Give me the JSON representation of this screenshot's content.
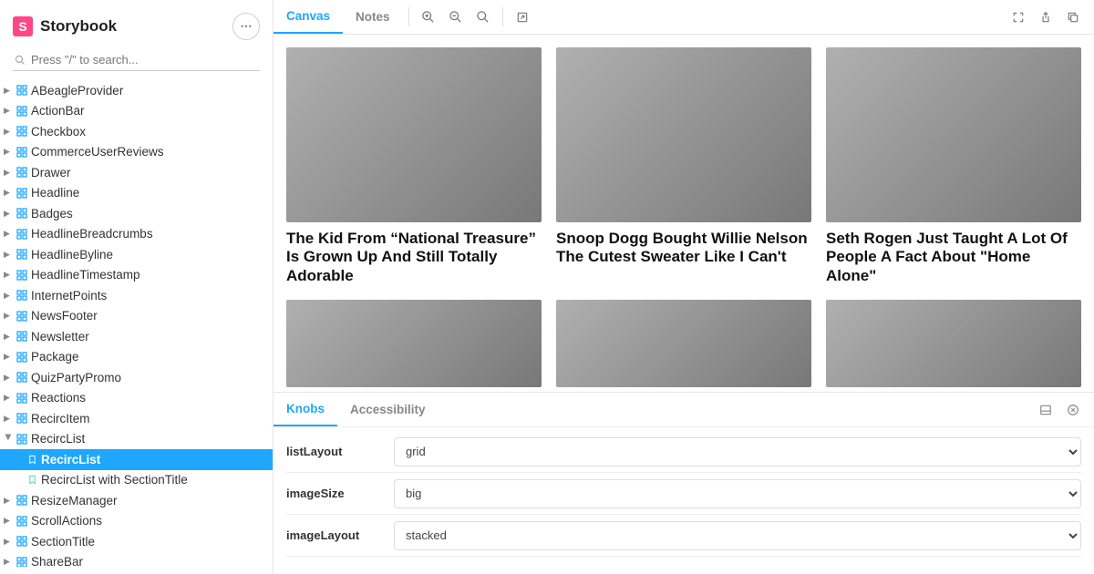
{
  "brand": {
    "name": "Storybook",
    "logo_letter": "S"
  },
  "search": {
    "placeholder": "Press \"/\" to search..."
  },
  "sidebar": {
    "items": [
      {
        "label": "ABeagleProvider",
        "type": "group"
      },
      {
        "label": "ActionBar",
        "type": "group"
      },
      {
        "label": "Checkbox",
        "type": "group"
      },
      {
        "label": "CommerceUserReviews",
        "type": "group"
      },
      {
        "label": "Drawer",
        "type": "group"
      },
      {
        "label": "Headline",
        "type": "group"
      },
      {
        "label": "Badges",
        "type": "group"
      },
      {
        "label": "HeadlineBreadcrumbs",
        "type": "group"
      },
      {
        "label": "HeadlineByline",
        "type": "group"
      },
      {
        "label": "HeadlineTimestamp",
        "type": "group"
      },
      {
        "label": "InternetPoints",
        "type": "group"
      },
      {
        "label": "NewsFooter",
        "type": "group"
      },
      {
        "label": "Newsletter",
        "type": "group"
      },
      {
        "label": "Package",
        "type": "group"
      },
      {
        "label": "QuizPartyPromo",
        "type": "group"
      },
      {
        "label": "Reactions",
        "type": "group"
      },
      {
        "label": "RecircItem",
        "type": "group"
      },
      {
        "label": "RecircList",
        "type": "group",
        "open": true,
        "children": [
          {
            "label": "RecircList",
            "selected": true
          },
          {
            "label": "RecircList with SectionTitle",
            "selected": false
          }
        ]
      },
      {
        "label": "ResizeManager",
        "type": "group"
      },
      {
        "label": "ScrollActions",
        "type": "group"
      },
      {
        "label": "SectionTitle",
        "type": "group"
      },
      {
        "label": "ShareBar",
        "type": "group"
      }
    ]
  },
  "toolbar": {
    "tabs": [
      {
        "label": "Canvas",
        "active": true
      },
      {
        "label": "Notes",
        "active": false
      }
    ]
  },
  "cards": [
    {
      "title": "The Kid From “National Treasure” Is Grown Up And Still Totally Adorable"
    },
    {
      "title": "Snoop Dogg Bought Willie Nelson The Cutest Sweater Like I Can't"
    },
    {
      "title": "Seth Rogen Just Taught A Lot Of People A Fact About \"Home Alone\""
    },
    {
      "title": ""
    },
    {
      "title": ""
    },
    {
      "title": ""
    }
  ],
  "addons": {
    "tabs": [
      {
        "label": "Knobs",
        "active": true
      },
      {
        "label": "Accessibility",
        "active": false
      }
    ],
    "knobs": [
      {
        "label": "listLayout",
        "value": "grid"
      },
      {
        "label": "imageSize",
        "value": "big"
      },
      {
        "label": "imageLayout",
        "value": "stacked"
      }
    ]
  },
  "icons": {
    "ellipsis": "⋯"
  }
}
